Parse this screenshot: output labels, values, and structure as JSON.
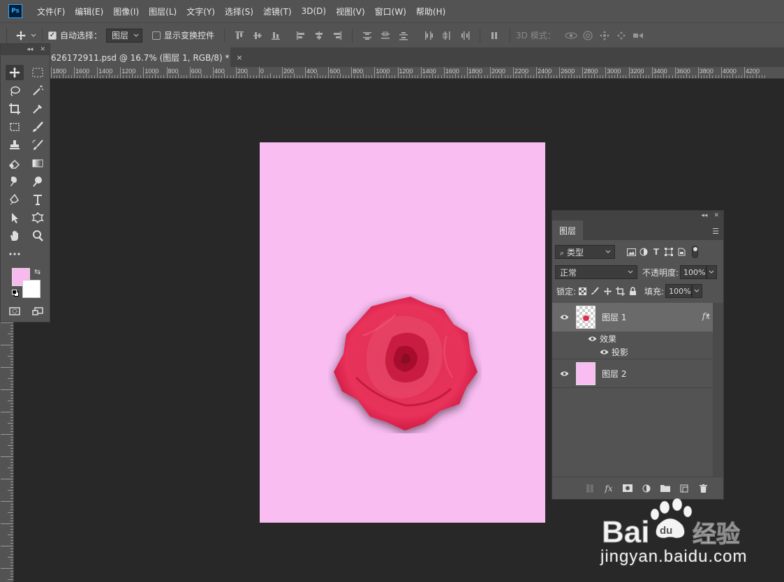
{
  "app": {
    "name": "Photoshop",
    "logo_text": "Ps"
  },
  "menu": [
    "文件(F)",
    "编辑(E)",
    "图像(I)",
    "图层(L)",
    "文字(Y)",
    "选择(S)",
    "滤镜(T)",
    "3D(D)",
    "视图(V)",
    "窗口(W)",
    "帮助(H)"
  ],
  "options_bar": {
    "auto_select_label": "自动选择：",
    "auto_select_checked": true,
    "auto_select_target": "图层",
    "show_transform_label": "显示变换控件",
    "show_transform_checked": false,
    "mode_3d_label": "3D 模式："
  },
  "document": {
    "tab_title": "626172911.psd @ 16.7% (图层 1, RGB/8) *",
    "tab_close": "×",
    "zoom": "16.7%",
    "canvas_color": "#f9bdf2"
  },
  "ruler": {
    "labels": [
      "1800",
      "1600",
      "1400",
      "1200",
      "1000",
      "800",
      "600",
      "400",
      "200",
      "0",
      "200",
      "400",
      "600",
      "800",
      "1000",
      "1200",
      "1400",
      "1600",
      "1800",
      "2000",
      "2200",
      "2400",
      "2600",
      "2800",
      "3000",
      "3200",
      "3400",
      "3600",
      "3800",
      "4000",
      "4200"
    ]
  },
  "colors": {
    "foreground": "#f9b8ee",
    "background": "#ffffff",
    "rose": "#e02a4f"
  },
  "layers_panel": {
    "tab": "图层",
    "filter_kind": "类型",
    "blend_mode": "正常",
    "opacity_label": "不透明度:",
    "opacity_value": "100%",
    "lock_label": "锁定:",
    "fill_label": "填充:",
    "fill_value": "100%",
    "layers": [
      {
        "name": "图层 1",
        "selected": true,
        "has_fx": true,
        "fx_label": "fx",
        "effects_label": "效果",
        "effect": "投影"
      },
      {
        "name": "图层 2",
        "selected": false
      }
    ]
  },
  "watermark": {
    "brand": "Bai du 经验",
    "url": "jingyan.baidu.com"
  }
}
